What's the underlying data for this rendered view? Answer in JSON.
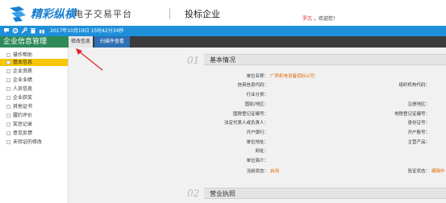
{
  "header": {
    "logo_text": "精彩纵横",
    "logo_sub": "电子交易平台",
    "page_role": "投标企业",
    "user_name": "罗志",
    "welcome": "，欢迎您！"
  },
  "toolbar": {
    "datetime": "2017年10月19日 15时42分34秒",
    "icons": [
      "comment-icon",
      "settings-icon",
      "wrench-icon",
      "trash-icon",
      "gift-icon"
    ]
  },
  "sidebar": {
    "title": "企业信息管理",
    "items": [
      {
        "label": "操作帮助"
      },
      {
        "label": "基本信息",
        "active": true
      },
      {
        "label": "企业资质"
      },
      {
        "label": "企业业绩"
      },
      {
        "label": "人员信息"
      },
      {
        "label": "企业获奖"
      },
      {
        "label": "其他证书"
      },
      {
        "label": "履约评价"
      },
      {
        "label": "奖惩记录"
      },
      {
        "label": "意见反馈"
      },
      {
        "label": "未验证的修改"
      }
    ]
  },
  "tabs": [
    {
      "label": "修改信息"
    },
    {
      "label": "扫描件查看"
    }
  ],
  "sections": [
    {
      "num": "01",
      "title": "基本情况"
    },
    {
      "num": "02",
      "title": "营业执照"
    }
  ],
  "fields_left": [
    {
      "label": "单位名称：",
      "value": "广西机电设备招标公司"
    },
    {
      "label": "信用信息代码：",
      "value": ""
    },
    {
      "label": "行业分类：",
      "value": ""
    },
    {
      "label": "国别/地区：",
      "value": ""
    },
    {
      "label": "国税登记证编号：",
      "value": ""
    },
    {
      "label": "法定代表人或负责人：",
      "value": ""
    },
    {
      "label": "开户银行：",
      "value": ""
    },
    {
      "label": "单位地址：",
      "value": ""
    },
    {
      "label": "网址：",
      "value": ""
    },
    {
      "label": "单位简介：",
      "value": ""
    },
    {
      "label": "当前状态：",
      "value": "启用"
    }
  ],
  "fields_right": [
    {
      "label": "组织机构代码：",
      "value": ""
    },
    {
      "label": "注册地区：",
      "value": ""
    },
    {
      "label": "地税登记证编号：",
      "value": ""
    },
    {
      "label": "身份证号：",
      "value": ""
    },
    {
      "label": "开户账号：",
      "value": ""
    },
    {
      "label": "主营产品：",
      "value": ""
    },
    {
      "label": "验证状态：",
      "value": "编辑中"
    }
  ],
  "colors": {
    "brand_blue": "#1f8fd9",
    "sidebar_green": "#2e8b57",
    "active_yellow": "#f7c600",
    "value_orange": "#e06a00",
    "annotation_red": "#e02020"
  }
}
